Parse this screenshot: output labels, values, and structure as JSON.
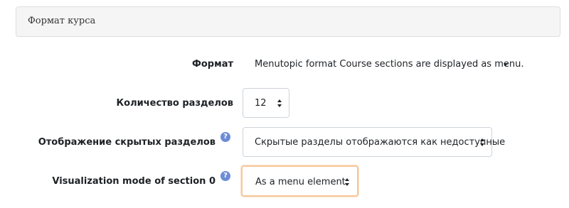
{
  "section": {
    "title": "Формат курса"
  },
  "fields": {
    "format": {
      "label": "Формат",
      "value": "Menutopic format Course sections are displayed as menu."
    },
    "num_sections": {
      "label": "Количество разделов",
      "value": "12"
    },
    "hidden_sections": {
      "label": "Отображение скрытых разделов",
      "value": "Скрытые разделы отображаются как недоступные",
      "help": "?"
    },
    "visualization_mode": {
      "label": "Visualization mode of section 0",
      "value": "As a menu element",
      "help": "?"
    }
  },
  "colors": {
    "header_bg": "#f5f5f5",
    "help_icon": "#6c8cd5",
    "focus_border": "#f6c89a"
  }
}
